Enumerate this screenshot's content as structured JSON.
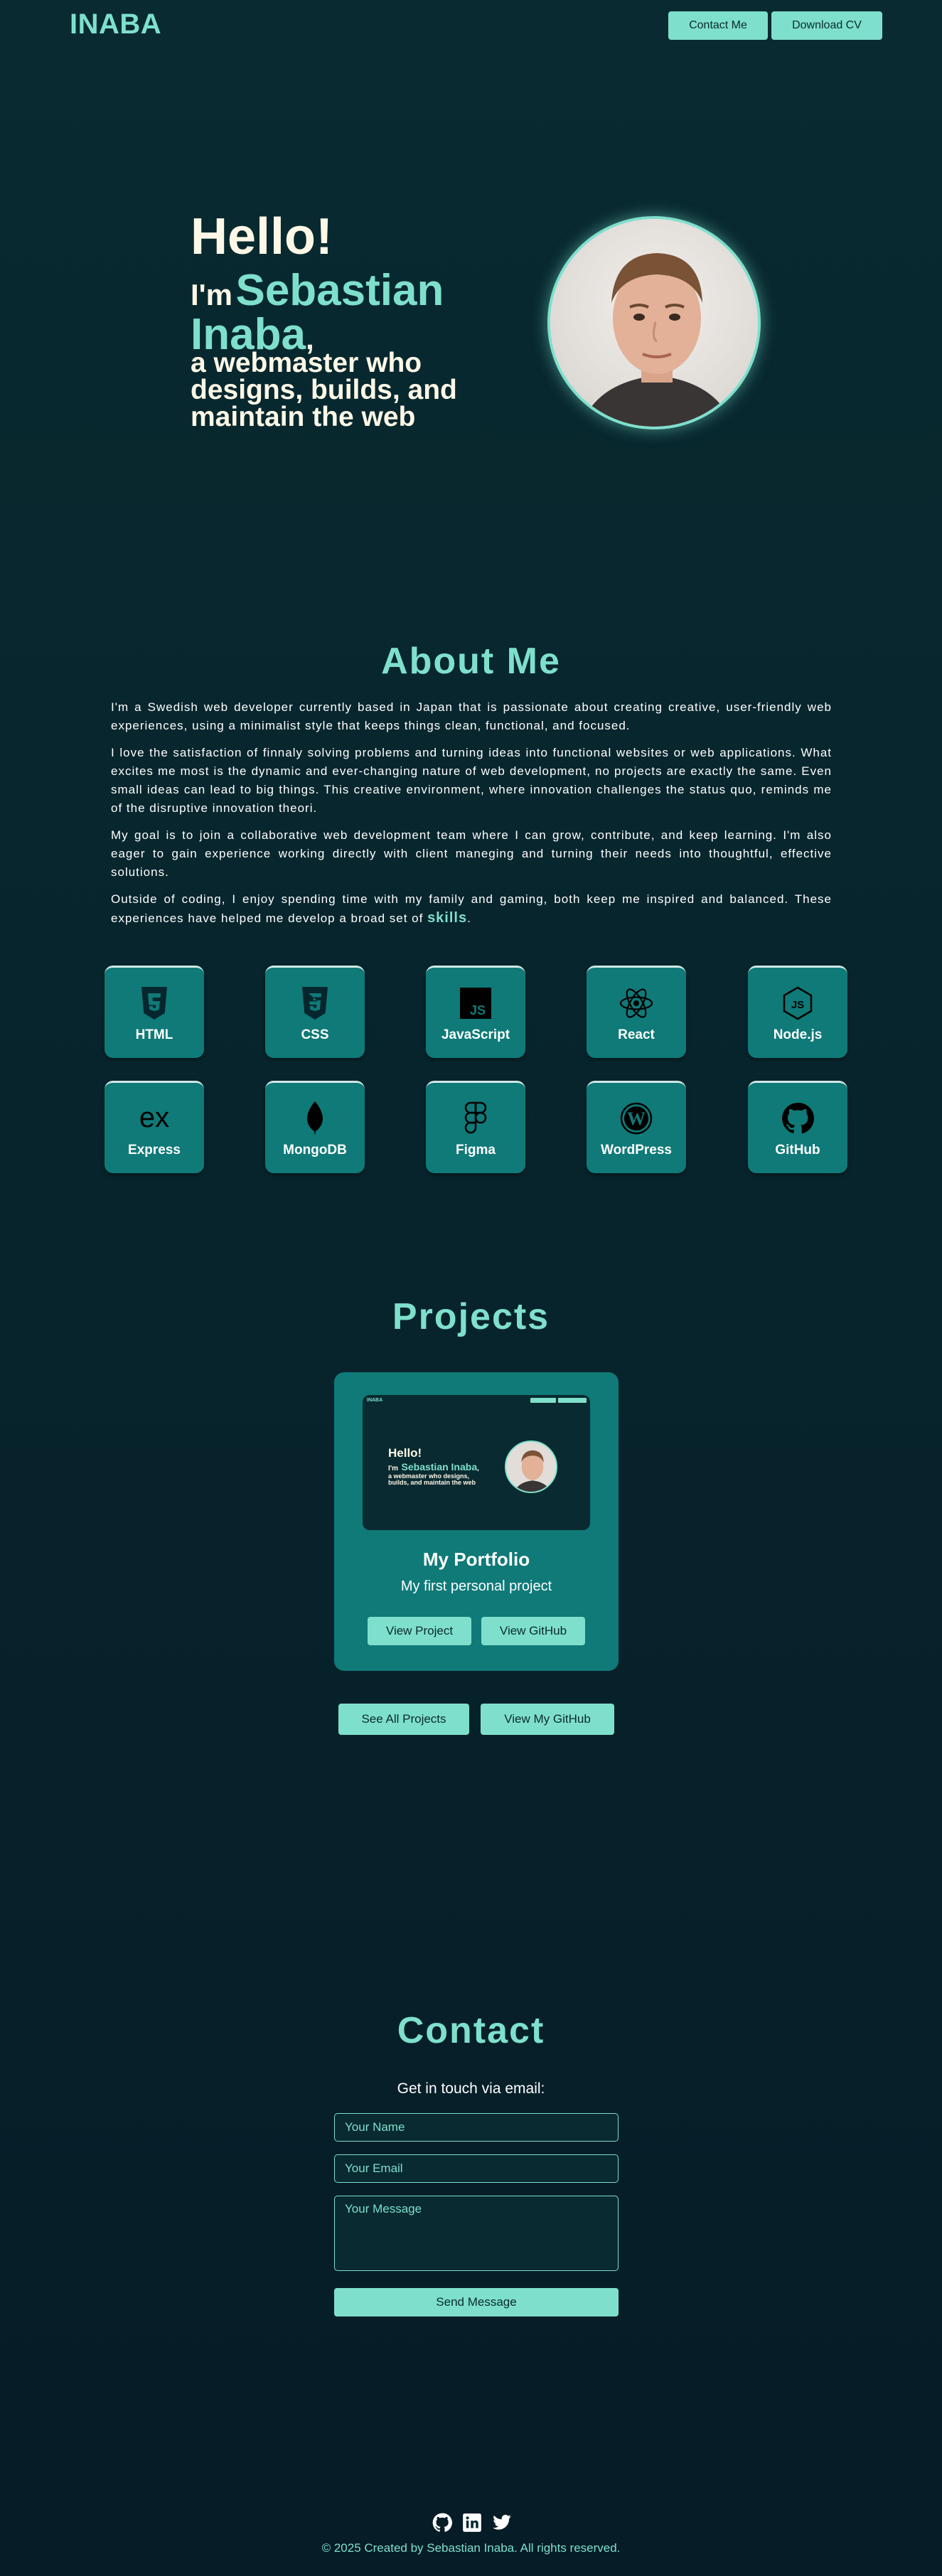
{
  "header": {
    "logo": "INABA",
    "contact_label": "Contact Me",
    "cv_label": "Download CV"
  },
  "hero": {
    "hello": "Hello!",
    "im": "I'm",
    "name": "Sebastian Inaba",
    "comma": ",",
    "tagline": "a webmaster who designs, builds, and maintain the web"
  },
  "about": {
    "title": "About Me",
    "p1": "I'm a Swedish web developer currently based in Japan that is passionate about creating creative, user-friendly web experiences, using a minimalist style that keeps things clean, functional, and focused.",
    "p2": "I love the satisfaction of finnaly solving problems and turning ideas into functional websites or web applications. What excites me most is the dynamic and ever-changing nature of web development, no projects are exactly the same. Even small ideas can lead to big things. This creative environment, where innovation challenges the status quo, reminds me of the disruptive innovation theori.",
    "p3": "My goal is to join a collaborative web development team where I can grow, contribute, and keep learning. I'm also eager to gain experience working directly with client maneging and turning their needs into thoughtful, effective solutions.",
    "p4": "Outside of coding, I enjoy spending time with my family and gaming, both keep me inspired and balanced. These experiences have helped me develop a broad set of",
    "skills_word": "skills",
    "period": "."
  },
  "skills": [
    {
      "label": "HTML",
      "icon": "html5-icon"
    },
    {
      "label": "CSS",
      "icon": "css3-icon"
    },
    {
      "label": "JavaScript",
      "icon": "javascript-icon"
    },
    {
      "label": "React",
      "icon": "react-icon"
    },
    {
      "label": "Node.js",
      "icon": "nodejs-icon"
    },
    {
      "label": "Express",
      "icon": "express-icon"
    },
    {
      "label": "MongoDB",
      "icon": "mongodb-icon"
    },
    {
      "label": "Figma",
      "icon": "figma-icon"
    },
    {
      "label": "WordPress",
      "icon": "wordpress-icon"
    },
    {
      "label": "GitHub",
      "icon": "github-icon"
    }
  ],
  "projects": {
    "title": "Projects",
    "card": {
      "title": "My Portfolio",
      "description": "My first personal project",
      "view_project": "View Project",
      "view_github": "View GitHub",
      "preview": {
        "logo": "INABA",
        "hello": "Hello!",
        "im": "I'm",
        "name": "Sebastian Inaba",
        "tagline": "a webmaster who designs, builds, and maintain the web"
      }
    },
    "see_all": "See All Projects",
    "view_my_github": "View My GitHub"
  },
  "contact": {
    "title": "Contact",
    "subtitle": "Get in touch via email:",
    "name_placeholder": "Your Name",
    "email_placeholder": "Your Email",
    "message_placeholder": "Your Message",
    "send": "Send Message"
  },
  "footer": {
    "text": "© 2025 Created by Sebastian Inaba. All rights reserved.",
    "socials": [
      "github-icon",
      "linkedin-icon",
      "twitter-icon"
    ]
  },
  "colors": {
    "accent": "#7ee0cc",
    "background": "#082a30",
    "card": "#0f7a78",
    "cream": "#fff7e6"
  }
}
